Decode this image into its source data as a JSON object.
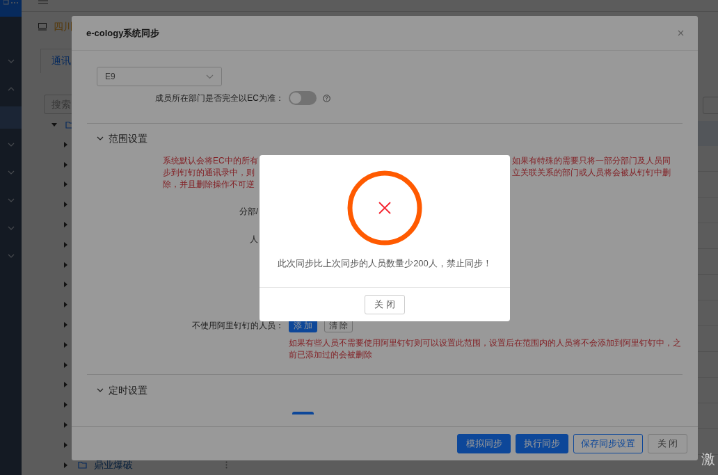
{
  "sidebar": {
    "items": [
      {
        "expanded": false
      },
      {
        "expanded": true,
        "children": [
          {
            "selected": true
          }
        ]
      },
      {
        "expanded": false
      },
      {
        "expanded": false
      },
      {
        "expanded": false
      },
      {
        "expanded": false
      },
      {
        "expanded": false
      }
    ]
  },
  "page": {
    "title": "四川",
    "tab": "通讯",
    "search": {
      "placeholder": "搜索"
    },
    "tree": {
      "expanded": true,
      "children": [
        {
          "expanded": false
        },
        {
          "expanded": false
        },
        {
          "expanded": false
        },
        {
          "expanded": false
        },
        {
          "expanded": false
        },
        {
          "expanded": false
        },
        {
          "expanded": false
        },
        {
          "expanded": false
        },
        {
          "expanded": false
        },
        {
          "expanded": false
        },
        {
          "expanded": false
        },
        {
          "expanded": false
        },
        {
          "expanded": false
        },
        {
          "expanded": false
        },
        {
          "expanded": false
        },
        {
          "expanded": false
        },
        {
          "label": "鼎业爆破",
          "expanded": false
        }
      ]
    }
  },
  "dialog": {
    "title": "e-cology系统同步",
    "version_select": {
      "value": "E9"
    },
    "dept_toggle": {
      "label": "成员所在部门是否完全以EC为准：",
      "on": false
    },
    "sections": [
      {
        "title": "范围设置",
        "expanded": true
      },
      {
        "title": "定时设置",
        "expanded": true
      }
    ],
    "scope_note": {
      "left_lines": [
        "系统默认会将EC中的所有",
        "步到钉钉的通讯录中，则",
        "除，并且删除操作不可逆"
      ],
      "right_lines": [
        "如果有特殊的需要只将一部分部门及人员同",
        "立关联关系的部门或人员将会被从钉钉中删"
      ]
    },
    "scope_fields": [
      "分部/",
      "人"
    ],
    "exclude_row": {
      "label": "不使用阿里钉钉的人员：",
      "add_button": "添 加",
      "clear_button": "清 除",
      "note": "如果有些人员不需要使用阿里钉钉则可以设置此范围，设置后在范围内的人员将不会添加到阿里钉钉中，之前已添加过的会被删除"
    },
    "buttons": [
      {
        "label": "模拟同步",
        "kind": "primary"
      },
      {
        "label": "执行同步",
        "kind": "primary"
      },
      {
        "label": "保存同步设置",
        "kind": "outline"
      },
      {
        "label": "关 闭",
        "kind": "default"
      }
    ]
  },
  "alert": {
    "message": "此次同步比上次同步的人员数量少200人，禁止同步！",
    "button": "关 闭"
  },
  "os_notice": "激"
}
